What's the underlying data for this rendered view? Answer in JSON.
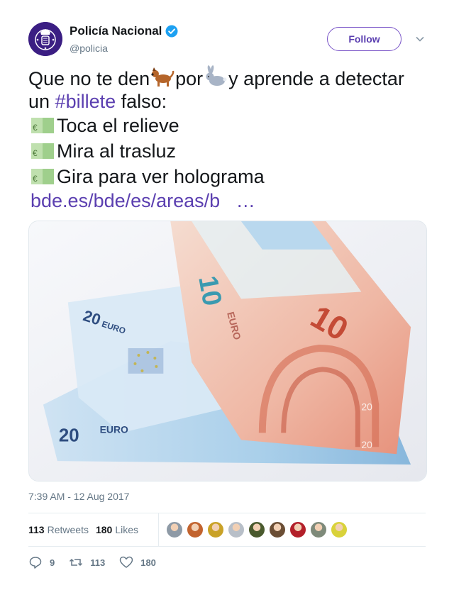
{
  "author": {
    "display_name": "Policía Nacional",
    "handle": "@policia",
    "verified": true
  },
  "follow_label": "Follow",
  "tweet": {
    "line1_before": "Que no te den",
    "line1_mid": "por",
    "line1_after": "y aprende a detectar",
    "line2_before": "un ",
    "hashtag": "#billete",
    "line2_after": " falso:",
    "bullets": [
      "Toca el relieve",
      "Mira al trasluz",
      "Gira para ver holograma"
    ],
    "link": "bde.es/bde/es/areas/b   …",
    "emojis": [
      "dog",
      "rabbit",
      "euro-banknote"
    ]
  },
  "media": {
    "alt": "Euro banknotes",
    "note_labels": [
      "10",
      "EURO",
      "20",
      "EURO",
      "20",
      "EURO",
      "20"
    ]
  },
  "timestamp": "7:39 AM - 12 Aug 2017",
  "stats": {
    "retweets_count": "113",
    "retweets_label": "Retweets",
    "likes_count": "180",
    "likes_label": "Likes",
    "liker_colors": [
      "#8e9aa6",
      "#c2632e",
      "#c9a227",
      "#b8bfc8",
      "#4a5a2e",
      "#6b4e35",
      "#b3202a",
      "#7e8a7a",
      "#d9d23a"
    ]
  },
  "actions": {
    "reply_count": "9",
    "retweet_count": "113",
    "like_count": "180"
  },
  "colors": {
    "accent": "#5b3fb0",
    "muted": "#657786",
    "verified": "#1da1f2"
  }
}
